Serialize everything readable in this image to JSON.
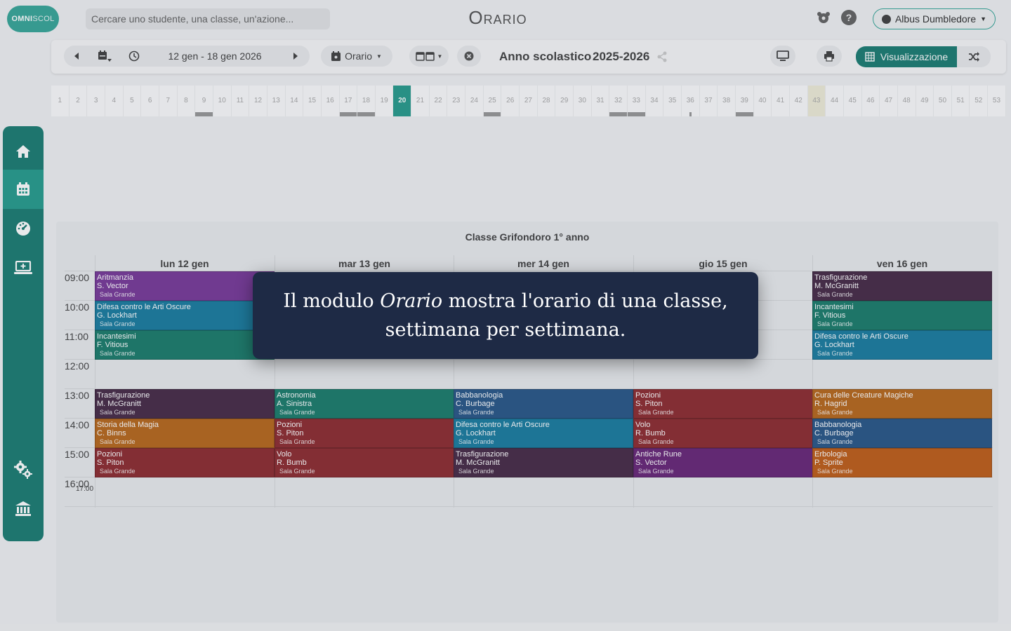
{
  "header": {
    "logo_left": "OMNI",
    "logo_right": "SCOL",
    "search_placeholder": "Cercare uno studente, una classe, un'azione...",
    "title": "Orario",
    "user_name": "Albus Dumbledore"
  },
  "toolbar": {
    "date_range": "12 gen - 18 gen 2026",
    "orario_label": "Orario",
    "year_label": "Anno scolastico",
    "year_value": "2025-2026",
    "viz_label": "Visualizzazione"
  },
  "weeks": {
    "numbers": [
      "1",
      "2",
      "3",
      "4",
      "5",
      "6",
      "7",
      "8",
      "9",
      "10",
      "11",
      "12",
      "13",
      "14",
      "15",
      "16",
      "17",
      "18",
      "19",
      "20",
      "21",
      "22",
      "23",
      "24",
      "25",
      "26",
      "27",
      "28",
      "29",
      "30",
      "31",
      "32",
      "33",
      "34",
      "35",
      "36",
      "37",
      "38",
      "39",
      "40",
      "41",
      "42",
      "43",
      "44",
      "45",
      "46",
      "47",
      "48",
      "49",
      "50",
      "51",
      "52",
      "53"
    ],
    "selected": "20",
    "highlighted": "43",
    "marked": [
      "9",
      "17",
      "18",
      "25",
      "32",
      "33",
      "36",
      "39"
    ]
  },
  "timetable": {
    "title": "Classe Grifondoro 1° anno",
    "days": [
      "lun 12 gen",
      "mar 13 gen",
      "mer 14 gen",
      "gio 15 gen",
      "ven 16 gen"
    ],
    "times": [
      "09:00",
      "10:00",
      "11:00",
      "12:00",
      "13:00",
      "14:00",
      "15:00",
      "16:00"
    ],
    "end_time": "17:00",
    "colors": {
      "purple": "#7a3d9a",
      "blue": "#1d7ea1",
      "teal": "#1f7e6e",
      "plum": "#4a2e4a",
      "orange": "#b86a20",
      "red": "#8f2f34",
      "darkblue": "#2c5a8a",
      "violet": "#6a2a7a",
      "darkorange": "#c0601c"
    },
    "lessons": [
      {
        "day": 0,
        "slot": 0,
        "subject": "Aritmanzia",
        "teacher": "S. Vector",
        "room": "Sala Grande",
        "color": "purple"
      },
      {
        "day": 0,
        "slot": 1,
        "subject": "Difesa contro le Arti Oscure",
        "teacher": "G. Lockhart",
        "room": "Sala Grande",
        "color": "blue"
      },
      {
        "day": 0,
        "slot": 2,
        "subject": "Incantesimi",
        "teacher": "F. Vitious",
        "room": "Sala Grande",
        "color": "teal"
      },
      {
        "day": 0,
        "slot": 4,
        "subject": "Trasfigurazione",
        "teacher": "M. McGranitt",
        "room": "Sala Grande",
        "color": "plum"
      },
      {
        "day": 0,
        "slot": 5,
        "subject": "Storia della Magia",
        "teacher": "C. Binns",
        "room": "Sala Grande",
        "color": "orange"
      },
      {
        "day": 0,
        "slot": 6,
        "subject": "Pozioni",
        "teacher": "S. Piton",
        "room": "Sala Grande",
        "color": "red"
      },
      {
        "day": 1,
        "slot": 4,
        "subject": "Astronomia",
        "teacher": "A. Sinistra",
        "room": "Sala Grande",
        "color": "teal"
      },
      {
        "day": 1,
        "slot": 5,
        "subject": "Pozioni",
        "teacher": "S. Piton",
        "room": "Sala Grande",
        "color": "red"
      },
      {
        "day": 1,
        "slot": 6,
        "subject": "Volo",
        "teacher": "R. Bumb",
        "room": "Sala Grande",
        "color": "red"
      },
      {
        "day": 2,
        "slot": 4,
        "subject": "Babbanologia",
        "teacher": "C. Burbage",
        "room": "Sala Grande",
        "color": "darkblue"
      },
      {
        "day": 2,
        "slot": 5,
        "subject": "Difesa contro le Arti Oscure",
        "teacher": "G. Lockhart",
        "room": "Sala Grande",
        "color": "blue"
      },
      {
        "day": 2,
        "slot": 6,
        "subject": "Trasfigurazione",
        "teacher": "M. McGranitt",
        "room": "Sala Grande",
        "color": "plum"
      },
      {
        "day": 3,
        "slot": 4,
        "subject": "Pozioni",
        "teacher": "S. Piton",
        "room": "Sala Grande",
        "color": "red"
      },
      {
        "day": 3,
        "slot": 5,
        "subject": "Volo",
        "teacher": "R. Bumb",
        "room": "Sala Grande",
        "color": "red"
      },
      {
        "day": 3,
        "slot": 6,
        "subject": "Antiche Rune",
        "teacher": "S. Vector",
        "room": "Sala Grande",
        "color": "violet"
      },
      {
        "day": 4,
        "slot": 0,
        "subject": "Trasfigurazione",
        "teacher": "M. McGranitt",
        "room": "Sala Grande",
        "color": "plum"
      },
      {
        "day": 4,
        "slot": 1,
        "subject": "Incantesimi",
        "teacher": "F. Vitious",
        "room": "Sala Grande",
        "color": "teal"
      },
      {
        "day": 4,
        "slot": 2,
        "subject": "Difesa contro le Arti Oscure",
        "teacher": "G. Lockhart",
        "room": "Sala Grande",
        "color": "blue"
      },
      {
        "day": 4,
        "slot": 4,
        "subject": "Cura delle Creature Magiche",
        "teacher": "R. Hagrid",
        "room": "Sala Grande",
        "color": "orange"
      },
      {
        "day": 4,
        "slot": 5,
        "subject": "Babbanologia",
        "teacher": "C. Burbage",
        "room": "Sala Grande",
        "color": "darkblue"
      },
      {
        "day": 4,
        "slot": 6,
        "subject": "Erbologia",
        "teacher": "P. Sprite",
        "room": "Sala Grande",
        "color": "darkorange"
      }
    ]
  },
  "tooltip": {
    "line1_before": "Il modulo ",
    "line1_emph": "Orario",
    "line1_after": " mostra l'orario di una classe,",
    "line2": "settimana per settimana."
  }
}
